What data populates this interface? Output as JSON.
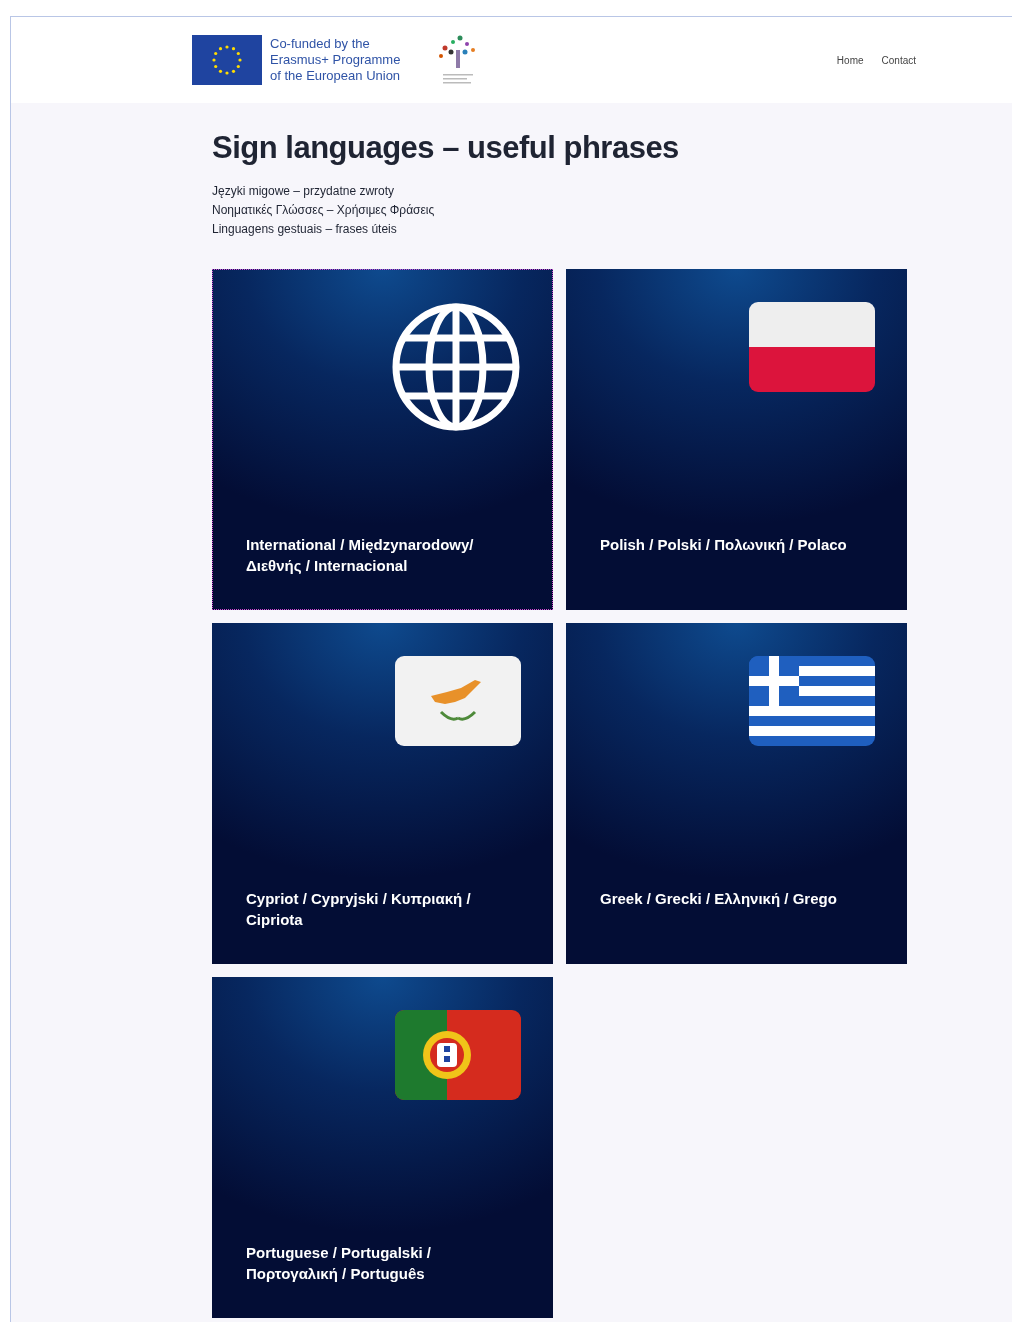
{
  "header": {
    "funding_text": [
      "Co-funded by the",
      "Erasmus+ Programme",
      "of the European Union"
    ],
    "nav": [
      {
        "label": "Home"
      },
      {
        "label": "Contact"
      }
    ]
  },
  "title": "Sign languages – useful phrases",
  "subtitles": [
    "Języki migowe – przydatne zwroty",
    "Νοηματικές Γλώσσες – Χρήσιμες Φράσεις",
    "Linguagens gestuais – frases úteis"
  ],
  "tiles": [
    {
      "label": "International / Międzynarodowy/ Διεθνής / Internacional",
      "kind": "globe",
      "focused": true
    },
    {
      "label": "Polish / Polski / Πολωνική / Polaco",
      "kind": "flag-pl",
      "focused": false
    },
    {
      "label": "Cypriot / Cypryjski / Κυπριακή / Cipriota",
      "kind": "flag-cy",
      "focused": false
    },
    {
      "label": "Greek / Grecki / Ελληνική / Grego",
      "kind": "flag-gr",
      "focused": false
    },
    {
      "label": "Portuguese / Portugalski / Πορτογαλική / Português",
      "kind": "flag-pt",
      "focused": false
    }
  ]
}
